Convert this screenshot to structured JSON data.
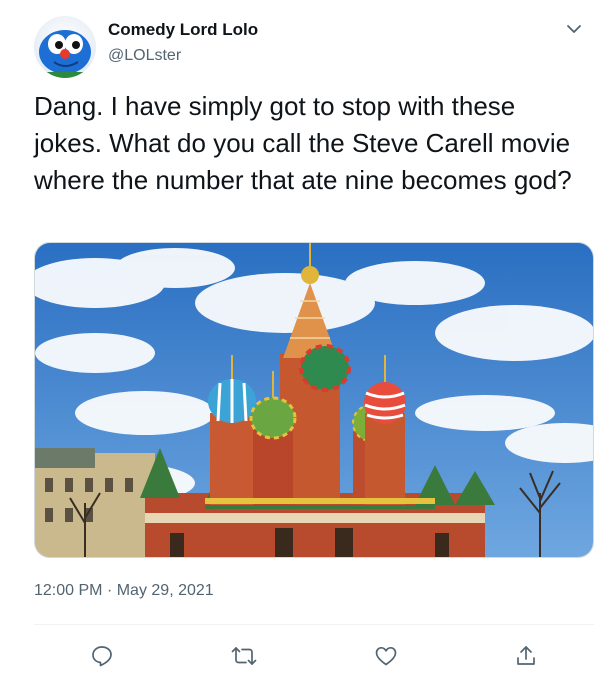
{
  "user": {
    "display_name": "Comedy Lord Lolo",
    "handle": "@LOLster"
  },
  "tweet": {
    "text": "Dang. I have simply got to stop with these jokes. What do you call the Steve Carell movie where the number that ate nine becomes god?",
    "time": "12:00 PM",
    "separator": "·",
    "date": "May 29, 2021"
  },
  "icons": {
    "more": "chevron-down-icon",
    "reply": "reply-icon",
    "retweet": "retweet-icon",
    "like": "heart-icon",
    "share": "share-icon"
  },
  "colors": {
    "text": "#0f1419",
    "secondary": "#536471",
    "icon": "#536471",
    "divider": "#eff3f4",
    "sky": "#2f78c8"
  }
}
